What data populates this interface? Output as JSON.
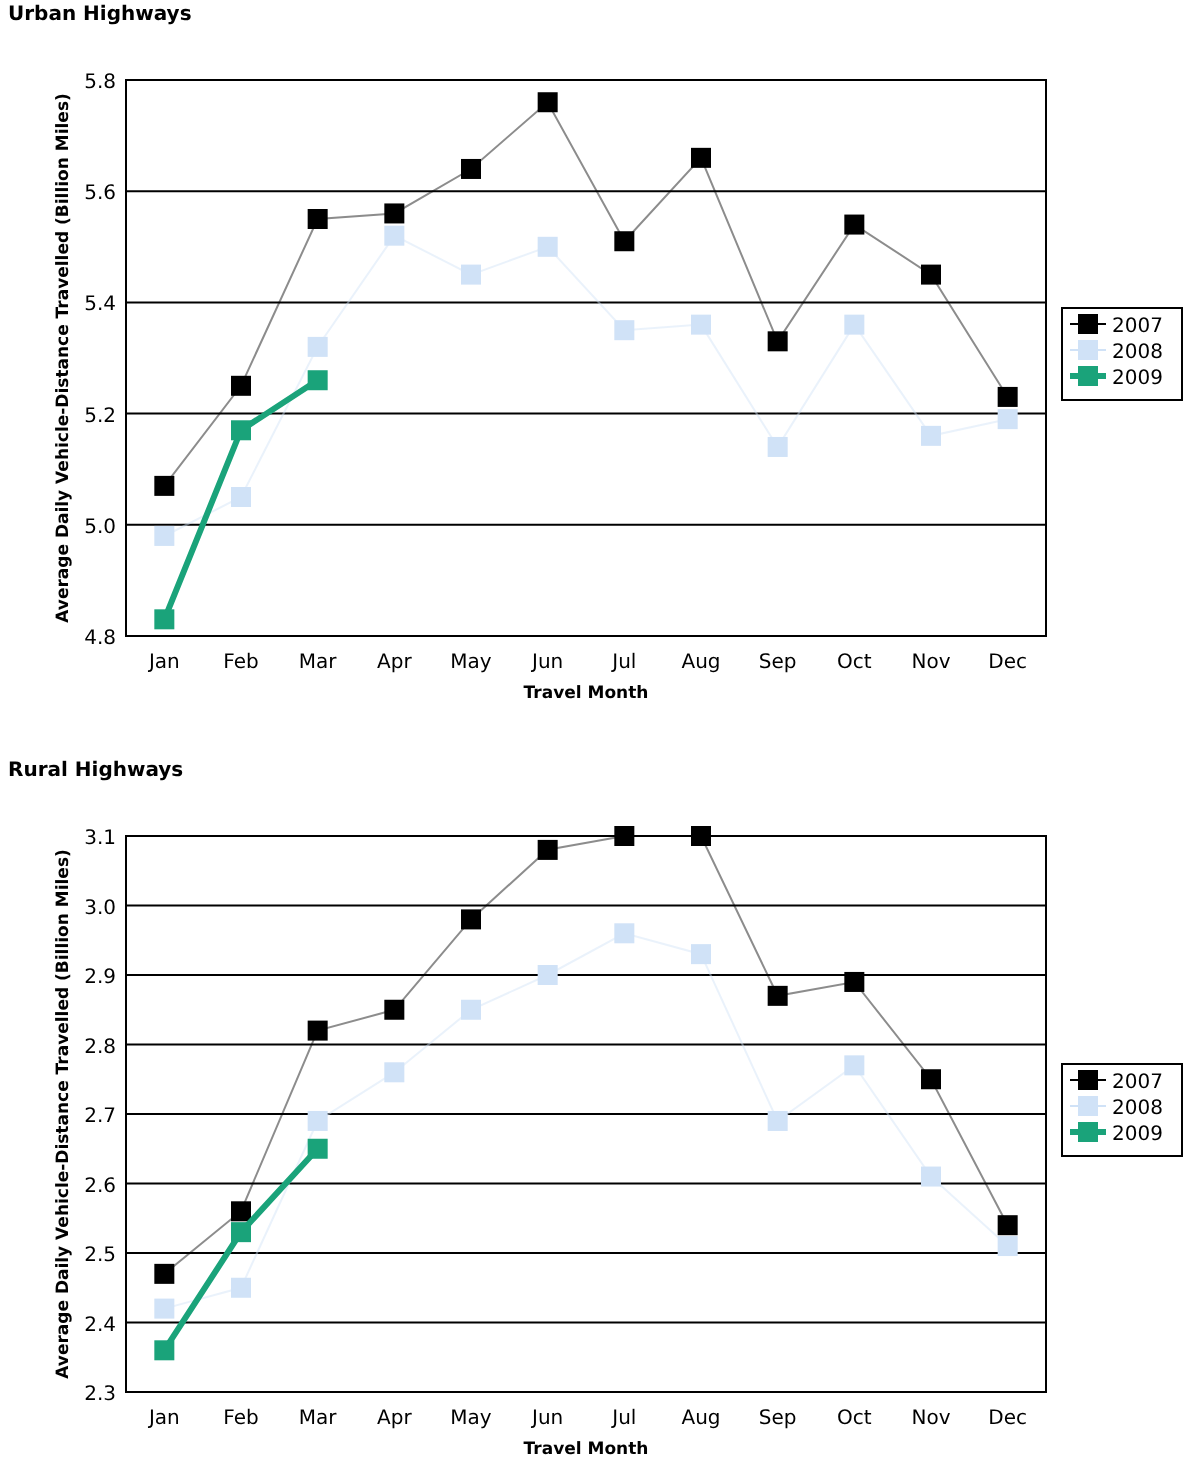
{
  "charts": [
    {
      "title": "Urban Highways",
      "chart_data": {
        "type": "line",
        "xlabel": "Travel Month",
        "ylabel": "Average Daily Vehicle-Distance Travelled (Billion Miles)",
        "categories": [
          "Jan",
          "Feb",
          "Mar",
          "Apr",
          "May",
          "Jun",
          "Jul",
          "Aug",
          "Sep",
          "Oct",
          "Nov",
          "Dec"
        ],
        "ylim": [
          4.8,
          5.8
        ],
        "yticks": [
          4.8,
          {
            "value": 5,
            "label": "5.0"
          },
          5.2,
          5.4,
          5.6,
          5.8
        ],
        "grid": true,
        "legend": "right",
        "series": [
          {
            "name": "2007",
            "color": "#000000",
            "marker": "square",
            "values": [
              5.07,
              5.25,
              5.55,
              5.56,
              5.64,
              5.76,
              5.51,
              5.66,
              5.33,
              5.54,
              5.45,
              5.23
            ]
          },
          {
            "name": "2008",
            "color": "#d0e2f7",
            "marker": "square",
            "values": [
              4.98,
              5.05,
              5.32,
              5.52,
              5.45,
              5.5,
              5.35,
              5.36,
              5.14,
              5.36,
              5.16,
              5.19
            ]
          },
          {
            "name": "2009",
            "color": "#1aa37a",
            "marker": "square",
            "values": [
              4.83,
              5.17,
              5.26,
              null,
              null,
              null,
              null,
              null,
              null,
              null,
              null,
              null
            ]
          }
        ]
      }
    },
    {
      "title": "Rural Highways",
      "chart_data": {
        "type": "line",
        "xlabel": "Travel Month",
        "ylabel": "Average Daily Vehicle-Distance Travelled (Billion Miles)",
        "categories": [
          "Jan",
          "Feb",
          "Mar",
          "Apr",
          "May",
          "Jun",
          "Jul",
          "Aug",
          "Sep",
          "Oct",
          "Nov",
          "Dec"
        ],
        "ylim": [
          2.3,
          3.1
        ],
        "yticks": [
          2.3,
          2.4,
          2.5,
          2.6,
          2.7,
          2.8,
          2.9,
          {
            "value": 3,
            "label": "3.0"
          },
          3.1
        ],
        "grid": true,
        "legend": "right",
        "series": [
          {
            "name": "2007",
            "color": "#000000",
            "marker": "square",
            "values": [
              2.47,
              2.56,
              2.82,
              2.85,
              2.98,
              3.08,
              3.1,
              3.1,
              2.87,
              2.89,
              2.75,
              2.54
            ]
          },
          {
            "name": "2008",
            "color": "#d0e2f7",
            "marker": "square",
            "values": [
              2.42,
              2.45,
              2.69,
              2.76,
              2.85,
              2.9,
              2.96,
              2.93,
              2.69,
              2.77,
              2.61,
              2.51
            ]
          },
          {
            "name": "2009",
            "color": "#1aa37a",
            "marker": "square",
            "values": [
              2.36,
              2.53,
              2.65,
              null,
              null,
              null,
              null,
              null,
              null,
              null,
              null,
              null
            ]
          }
        ]
      }
    }
  ]
}
